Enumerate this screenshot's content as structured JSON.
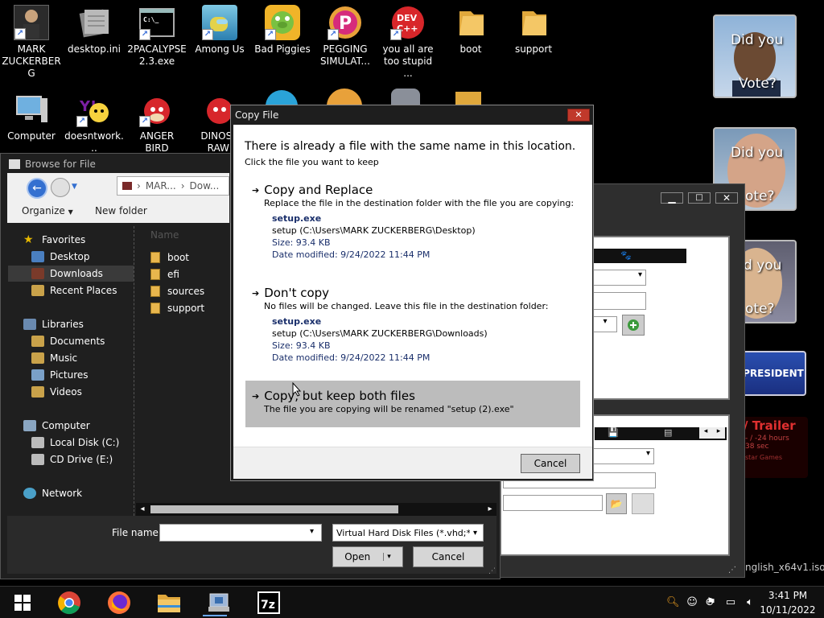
{
  "desktop": {
    "icons_row1": [
      {
        "label": "MARK ZUCKERBERG",
        "icon": "person-image-icon"
      },
      {
        "label": "desktop.ini",
        "icon": "ini-file-icon"
      },
      {
        "label": "2PACALYPSE 2.3.exe",
        "icon": "terminal-icon"
      },
      {
        "label": "Among Us",
        "icon": "among-us-icon"
      },
      {
        "label": "Bad Piggies",
        "icon": "pig-icon"
      },
      {
        "label": "PEGGING SIMULAT...",
        "icon": "p-logo-icon"
      },
      {
        "label": "you all are too stupid ...",
        "icon": "devcpp-icon"
      },
      {
        "label": "boot",
        "icon": "folder-icon"
      },
      {
        "label": "support",
        "icon": "folder-icon"
      }
    ],
    "icons_row2": [
      {
        "label": "Computer",
        "icon": "computer-icon"
      },
      {
        "label": "doesntwork...",
        "icon": "yahoo-icon"
      },
      {
        "label": "ANGER BIRD",
        "icon": "angry-bird-icon"
      },
      {
        "label": "DINOSA RAWI",
        "icon": "angry-bird-icon"
      }
    ],
    "posters": [
      {
        "line1": "Did you",
        "line2": "Vote?"
      },
      {
        "line1": "Did you",
        "line2": "ote?"
      },
      {
        "line1": "d you",
        "line2": "ote?"
      }
    ],
    "banner_president": "PRESIDENT",
    "trailer": {
      "title": "/ Trailer",
      "line1": "- / -24 hours",
      "line2": "38 sec",
      "line3": "star Games"
    },
    "iso_label": "nglish_x64v1.iso\\"
  },
  "browse": {
    "title": "Browse for File",
    "path": [
      "MAR...",
      "Dow..."
    ],
    "organize": "Organize",
    "new_folder": "New folder",
    "column_name": "Name",
    "nav": {
      "favorites": "Favorites",
      "desktop": "Desktop",
      "downloads": "Downloads",
      "recent": "Recent Places",
      "libraries": "Libraries",
      "documents": "Documents",
      "music": "Music",
      "pictures": "Pictures",
      "videos": "Videos",
      "computer": "Computer",
      "local_disk": "Local Disk (C:)",
      "cd_drive": "CD Drive (E:)",
      "network": "Network"
    },
    "files": [
      "boot",
      "efi",
      "sources",
      "support"
    ],
    "file_name_label": "File name:",
    "file_name_value": "",
    "file_type": "Virtual Hard Disk Files (*.vhd;*.v",
    "open": "Open",
    "cancel": "Cancel"
  },
  "dialog": {
    "title": "Copy File",
    "heading": "There is already a file with the same name in this location.",
    "subheading": "Click the file you want to keep",
    "replace": {
      "title": "Copy and Replace",
      "desc": "Replace the file in the destination folder with the file you are copying:",
      "file": "setup.exe",
      "path": "setup (C:\\Users\\MARK ZUCKERBERG\\Desktop)",
      "size": "Size: 93.4 KB",
      "date": "Date modified: 9/24/2022 11:44 PM"
    },
    "dont": {
      "title": "Don't copy",
      "desc": "No files will be changed. Leave this file in the destination folder:",
      "file": "setup.exe",
      "path": "setup (C:\\Users\\MARK ZUCKERBERG\\Downloads)",
      "size": "Size: 93.4 KB",
      "date": "Date modified: 9/24/2022 11:44 PM"
    },
    "both": {
      "title": "Copy, but keep both files",
      "desc": "The file you are copying will be renamed \"setup (2).exe\""
    },
    "cancel": "Cancel"
  },
  "taskbar": {
    "time": "3:41 PM",
    "date": "10/11/2022"
  },
  "colors": {
    "dialog_bg": "#ffffff",
    "dialog_title_bg": "#1e1e1e",
    "close_red": "#c0392b",
    "highlight_option": "#b9b9b9",
    "explorer_bg": "#1f1f1f"
  }
}
